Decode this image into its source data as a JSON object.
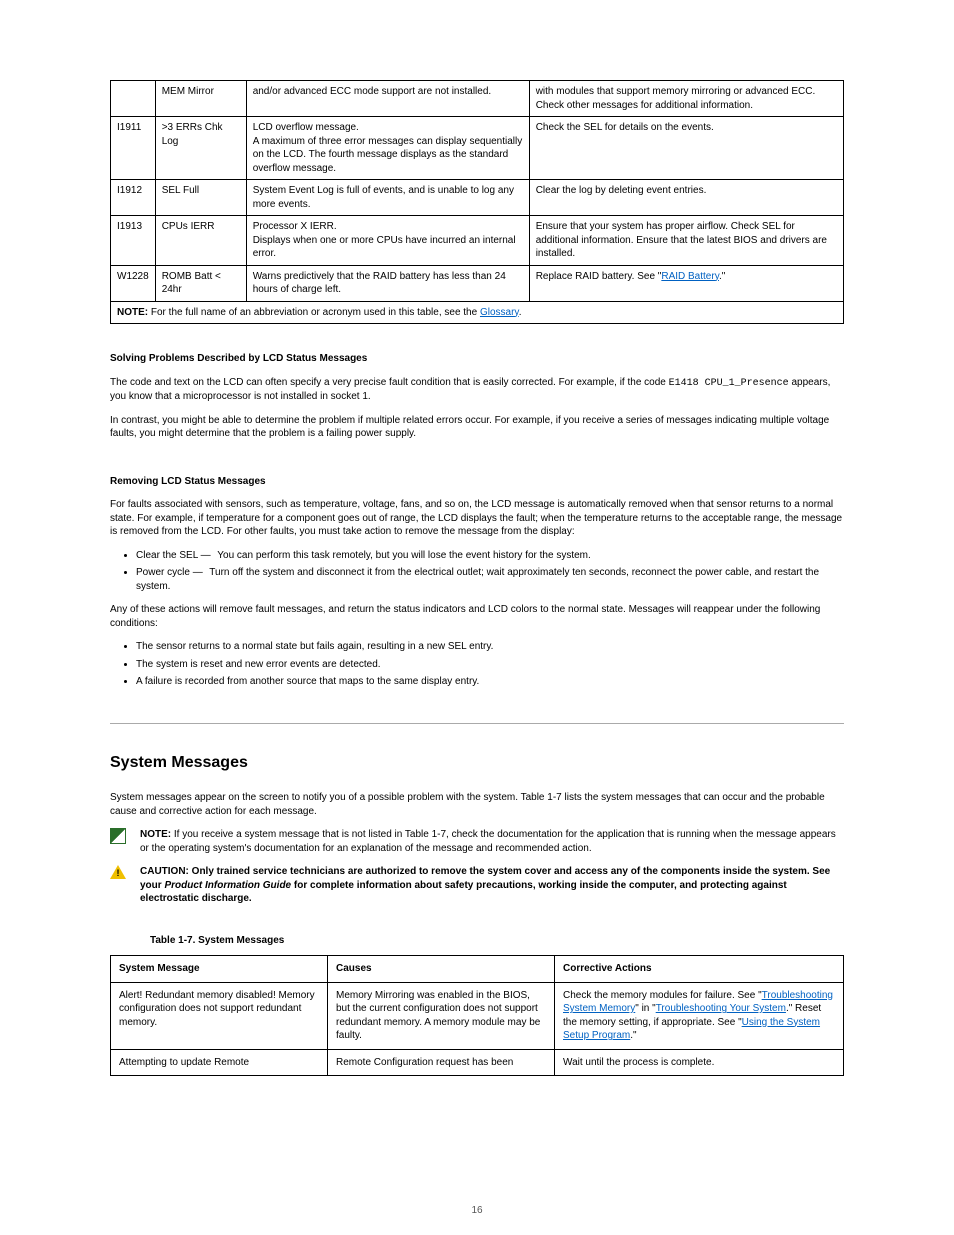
{
  "codes_table": {
    "rows": [
      {
        "code": "",
        "text": "MEM Mirror",
        "causes": "and/or advanced ECC mode support are not installed.",
        "actions": "with modules that support memory mirroring or advanced ECC. Check other messages for additional information."
      },
      {
        "code": "I1911",
        "text": ">3 ERRs Chk Log",
        "causes": "LCD overflow message.\nA maximum of three error messages can display sequentially on the LCD. The fourth message displays as the standard overflow message.",
        "actions": "Check the SEL for details on the events."
      },
      {
        "code": "I1912",
        "text": "SEL Full",
        "causes": "System Event Log is full of events, and is unable to log any more events.",
        "actions": "Clear the log by deleting event entries."
      },
      {
        "code": "I1913",
        "text": "CPUs IERR",
        "causes": "Processor X IERR.\nDisplays when one or more CPUs have incurred an internal error.",
        "actions": "Ensure that your system has proper airflow. Check SEL for additional information. Ensure that the latest BIOS and drivers are installed."
      },
      {
        "code": "W1228",
        "text": "ROMB Batt < 24hr",
        "causes": "Warns predictively that the RAID battery has less than 24 hours of charge left.",
        "actions": "Replace RAID battery. See \"<a class=\"link\" href=\"#\">RAID Battery</a>.\""
      }
    ],
    "note": "<b>NOTE:</b> For the full name of an abbreviation or acronym used in this table, see the <a class=\"link\" href=\"#\">Glossary</a>."
  },
  "solving": {
    "p1": "The code and text on the LCD can often specify a very precise fault condition that is easily corrected. For example, if the code <span class=\"mono\">E1418 CPU_1_Presence</span> appears, you know that a microprocessor is not installed in socket 1.",
    "p2": "In contrast, you might be able to determine the problem if multiple related errors occur. For example, if you receive a series of messages indicating multiple voltage faults, you might determine that the problem is a failing power supply."
  },
  "removing": {
    "heading": "Removing LCD Status Messages",
    "intro": "For faults associated with sensors, such as temperature, voltage, fans, and so on, the LCD message is automatically removed when that sensor returns to a normal state. For example, if temperature for a component goes out of range, the LCD displays the fault; when the temperature returns to the acceptable range, the message is removed from the LCD. For other faults, you must take action to remove the message from the display:",
    "items": [
      {
        "label": "Clear the SEL",
        "rest": "You can perform this task remotely, but you will lose the event history for the system."
      },
      {
        "label": "Power cycle",
        "rest": "Turn off the system and disconnect it from the electrical outlet; wait approximately ten seconds, reconnect the power cable, and restart the system."
      }
    ],
    "after": "Any of these actions will remove fault messages, and return the status indicators and LCD colors to the normal state. Messages will reappear under the following conditions:",
    "conds": [
      "The sensor returns to a normal state but fails again, resulting in a new SEL entry.",
      "The system is reset and new error events are detected.",
      "A failure is recorded from another source that maps to the same display entry."
    ]
  },
  "sys_heading": "System Messages",
  "sys_intro": "System messages appear on the screen to notify you of a possible problem with the system. Table 1-7 lists the system messages that can occur and the probable cause and corrective action for each message.",
  "note_text": "<b>NOTE:</b> If you receive a system message that is not listed in Table 1-7, check the documentation for the application that is running when the message appears or the operating system's documentation for an explanation of the message and recommended action.",
  "caution_text": "<b>CAUTION: Only trained service technicians are authorized to remove the system cover and access any of the components inside the system. See your <i>Product Information Guide</i> for complete information about safety precautions, working inside the computer, and protecting against electrostatic discharge.</b>",
  "tbl_title": "Table 1-7. System Messages",
  "msgs": {
    "headers": [
      "System Message",
      "Causes",
      "Corrective Actions"
    ],
    "rows": [
      {
        "msg": "Alert! Redundant memory disabled! Memory configuration does not support redundant memory.",
        "causes": "Memory Mirroring was enabled in the BIOS, but the current configuration does not support redundant memory. A memory module may be faulty.",
        "actions": "Check the memory modules for failure. See \"<a class=\"link\" href=\"#\">Troubleshooting System Memory</a>\" in \"<a class=\"link\" href=\"#\">Troubleshooting Your System</a>.\" Reset the memory setting, if appropriate. See \"<a class=\"link\" href=\"#\">Using the System Setup Program</a>.\""
      },
      {
        "msg": "Attempting to update Remote",
        "causes": "Remote Configuration request has been",
        "actions": "Wait until the process is complete."
      }
    ]
  },
  "footer": "16"
}
